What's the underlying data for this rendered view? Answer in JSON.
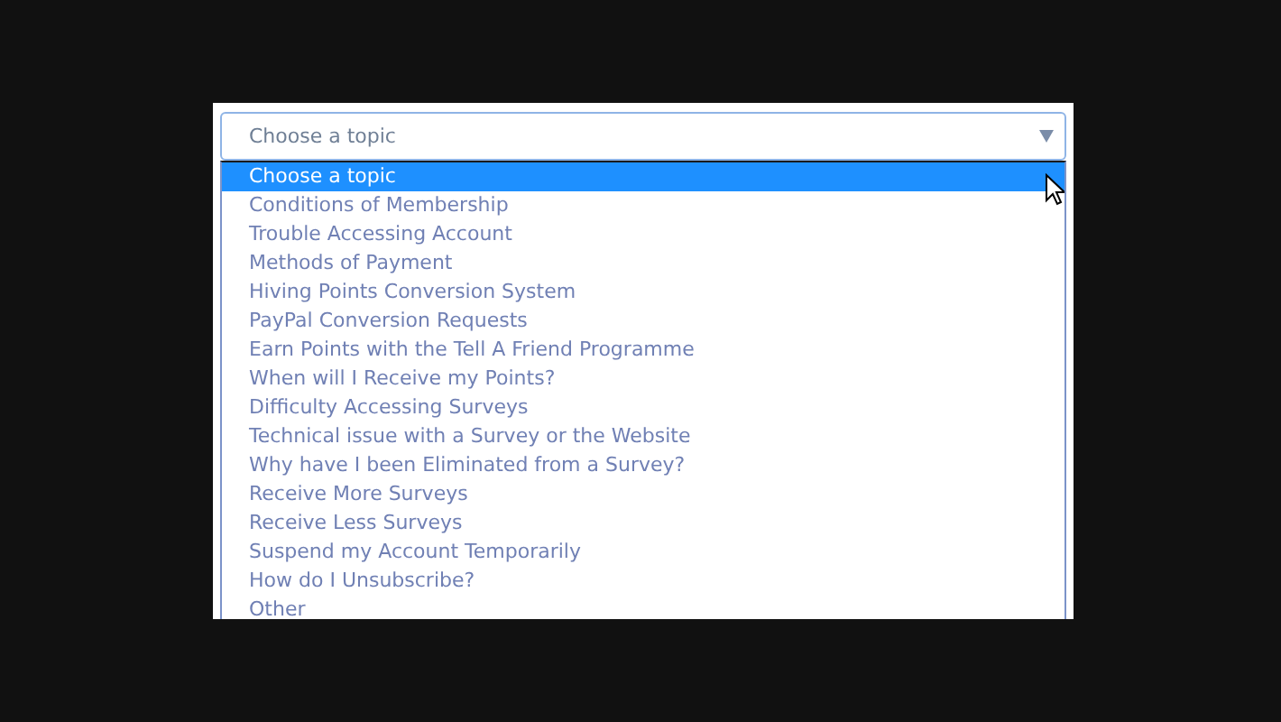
{
  "select": {
    "value": "Choose a topic",
    "expanded": true
  },
  "options": [
    {
      "label": "Choose a topic",
      "selected": true
    },
    {
      "label": "Conditions of Membership",
      "selected": false
    },
    {
      "label": "Trouble Accessing Account",
      "selected": false
    },
    {
      "label": "Methods of Payment",
      "selected": false
    },
    {
      "label": "Hiving Points Conversion System",
      "selected": false
    },
    {
      "label": "PayPal Conversion Requests",
      "selected": false
    },
    {
      "label": "Earn Points with the Tell A Friend Programme",
      "selected": false
    },
    {
      "label": "When will I Receive my Points?",
      "selected": false
    },
    {
      "label": "Difficulty Accessing Surveys",
      "selected": false
    },
    {
      "label": "Technical issue with a Survey or the Website",
      "selected": false
    },
    {
      "label": "Why have I been Eliminated from a Survey?",
      "selected": false
    },
    {
      "label": "Receive More Surveys",
      "selected": false
    },
    {
      "label": "Receive Less Surveys",
      "selected": false
    },
    {
      "label": "Suspend my Account Temporarily",
      "selected": false
    },
    {
      "label": "How do I Unsubscribe?",
      "selected": false
    },
    {
      "label": "Other",
      "selected": false
    }
  ]
}
